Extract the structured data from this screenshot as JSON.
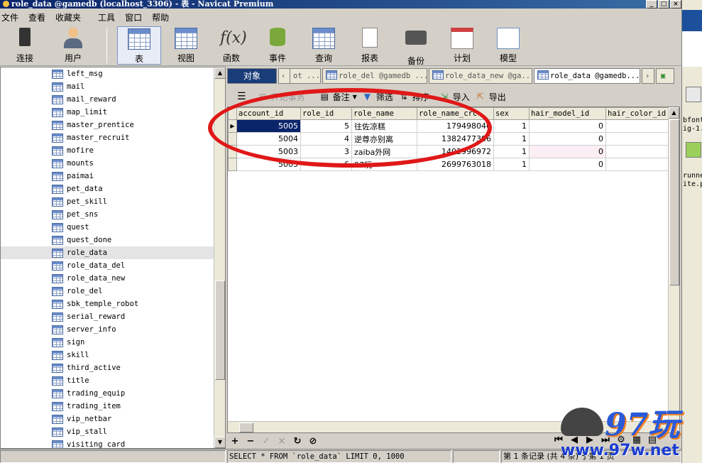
{
  "window": {
    "title": "role_data @gamedb (localhost_3306) - 表 - Navicat Premium"
  },
  "menu": [
    "文件",
    "查看",
    "收藏夹",
    "工具",
    "窗口",
    "帮助"
  ],
  "toolbar": {
    "connect": "连接",
    "user": "用户",
    "table": "表",
    "view": "视图",
    "function": "函数",
    "event": "事件",
    "query": "查询",
    "report": "报表",
    "backup": "备份",
    "schedule": "计划",
    "model": "模型"
  },
  "tree": {
    "selected": "role_data",
    "items": [
      "left_msg",
      "mail",
      "mail_reward",
      "map_limit",
      "master_prentice",
      "master_recruit",
      "mofire",
      "mounts",
      "paimai",
      "pet_data",
      "pet_skill",
      "pet_sns",
      "quest",
      "quest_done",
      "role_data",
      "role_data_del",
      "role_data_new",
      "role_del",
      "sbk_temple_robot",
      "serial_reward",
      "server_info",
      "sign",
      "skill",
      "third_active",
      "title",
      "trading_equip",
      "trading_item",
      "vip_netbar",
      "vip_stall",
      "visiting_card"
    ]
  },
  "tabs": {
    "objects": "对象",
    "t1": "ot ...",
    "t2": "role_del @gamedb ...",
    "t3": "role_data_new @ga...",
    "t4": "role_data @gamedb..."
  },
  "data_toolbar": {
    "begin_transaction": "开始事务",
    "memo": "备注",
    "filter": "筛选",
    "sort": "排序",
    "import": "导入",
    "export": "导出"
  },
  "grid": {
    "columns": [
      "account_id",
      "role_id",
      "role_name",
      "role_name_crc",
      "sex",
      "hair_model_id",
      "hair_color_id"
    ],
    "rows": [
      [
        "5005",
        "5",
        "往佐凉糕",
        "179498046",
        "1",
        "0",
        ""
      ],
      [
        "5004",
        "4",
        "逆尊亦别离",
        "1382477306",
        "1",
        "0",
        ""
      ],
      [
        "5003",
        "3",
        "zaiba外网",
        "1402996972",
        "1",
        "0",
        ""
      ],
      [
        "5005",
        "6",
        "97玩",
        "2699763018",
        "1",
        "0",
        ""
      ]
    ]
  },
  "status": {
    "sql": "SELECT * FROM `role_data` LIMIT 0, 1000",
    "records": "第 1 条记录 (共 4 条) 于第 1 页"
  },
  "watermark": {
    "brand": "97玩",
    "url": "www.97w.net"
  },
  "other_window": {
    "line1": "bfont",
    "line2": "ig-1.",
    "line3": "runnel",
    "line4": "ite.p"
  },
  "colors": {
    "selection": "#0a246a",
    "annotation": "#e01818",
    "objects_tab": "#1a3c78"
  }
}
